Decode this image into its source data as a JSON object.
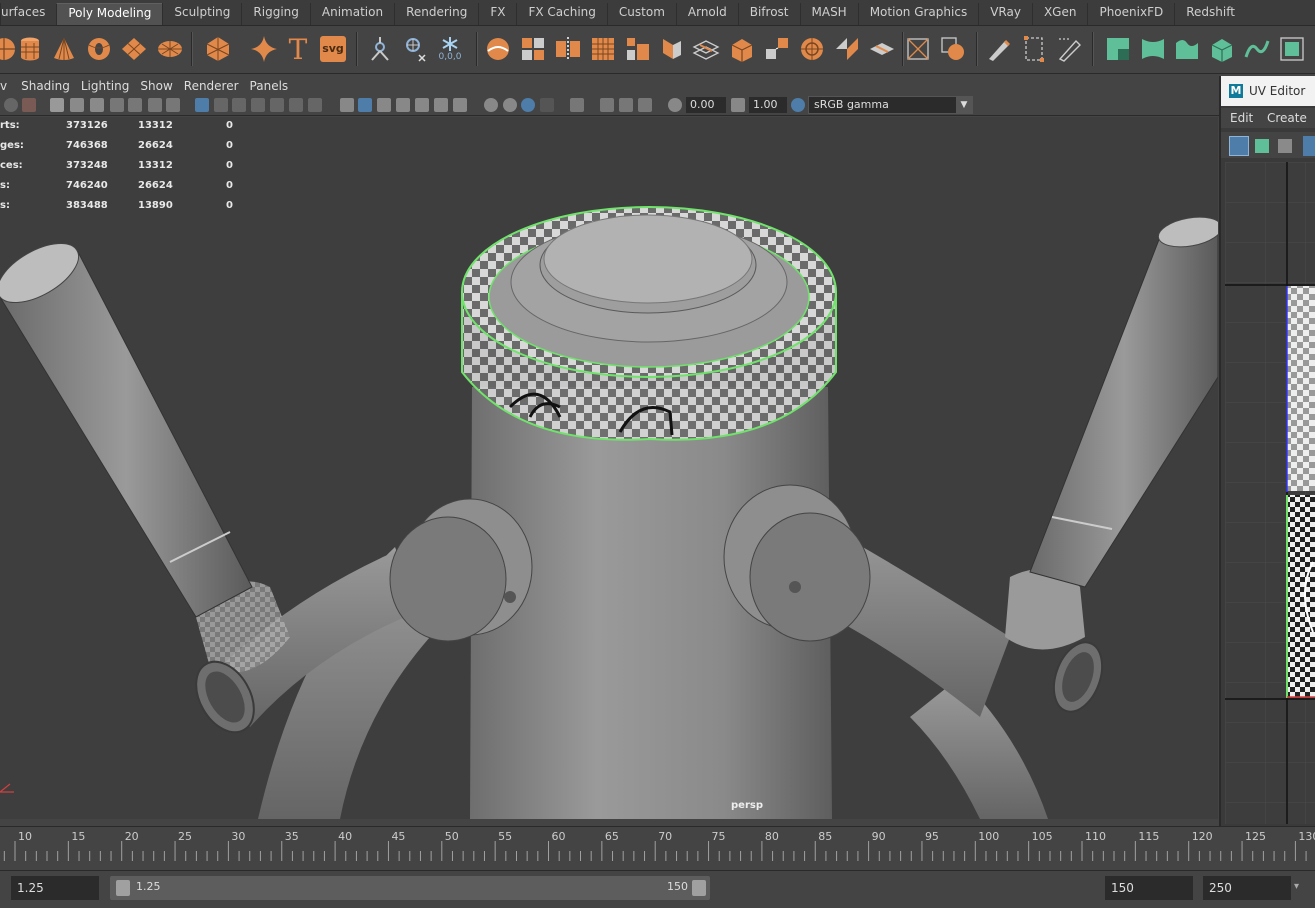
{
  "shelf": {
    "tabs": [
      "urfaces",
      "Poly Modeling",
      "Sculpting",
      "Rigging",
      "Animation",
      "Rendering",
      "FX",
      "FX Caching",
      "Custom",
      "Arnold",
      "Bifrost",
      "MASH",
      "Motion Graphics",
      "VRay",
      "XGen",
      "PhoenixFD",
      "Redshift"
    ],
    "active_tab": "Poly Modeling",
    "text_icon_label": "T",
    "svg_icon_label": "svg",
    "origin_icon_label": "0,0,0"
  },
  "viewport": {
    "menu": [
      "v",
      "Shading",
      "Lighting",
      "Show",
      "Renderer",
      "Panels"
    ],
    "exposure": "0.00",
    "gamma": "1.00",
    "colorspace": "sRGB gamma",
    "camera_label": "persp",
    "hud": [
      {
        "label": "rts:",
        "values": [
          "373126",
          "13312",
          "0"
        ]
      },
      {
        "label": "ges:",
        "values": [
          "746368",
          "26624",
          "0"
        ]
      },
      {
        "label": "ces:",
        "values": [
          "373248",
          "13312",
          "0"
        ]
      },
      {
        "label": "s:",
        "values": [
          "746240",
          "26624",
          "0"
        ]
      },
      {
        "label": "s:",
        "values": [
          "383488",
          "13890",
          "0"
        ]
      }
    ]
  },
  "uv_editor": {
    "title": "UV Editor",
    "logo": "M",
    "menu": [
      "Edit",
      "Create"
    ]
  },
  "timeline": {
    "ticks": [
      "10",
      "15",
      "20",
      "25",
      "30",
      "35",
      "40",
      "45",
      "50",
      "55",
      "60",
      "65",
      "70",
      "75",
      "80",
      "85",
      "90",
      "95",
      "100",
      "105",
      "110",
      "115",
      "120",
      "125",
      "130"
    ]
  },
  "range": {
    "anim_start": "1.25",
    "playback_start": "1.25",
    "playback_end": "150",
    "anim_end_a": "150",
    "anim_end_b": "250"
  },
  "colors": {
    "shelf_orange": "#e0894a",
    "shelf_teal": "#5fbf98",
    "selection_green": "#6fe36a",
    "toolbar_active": "#4d7da8"
  }
}
